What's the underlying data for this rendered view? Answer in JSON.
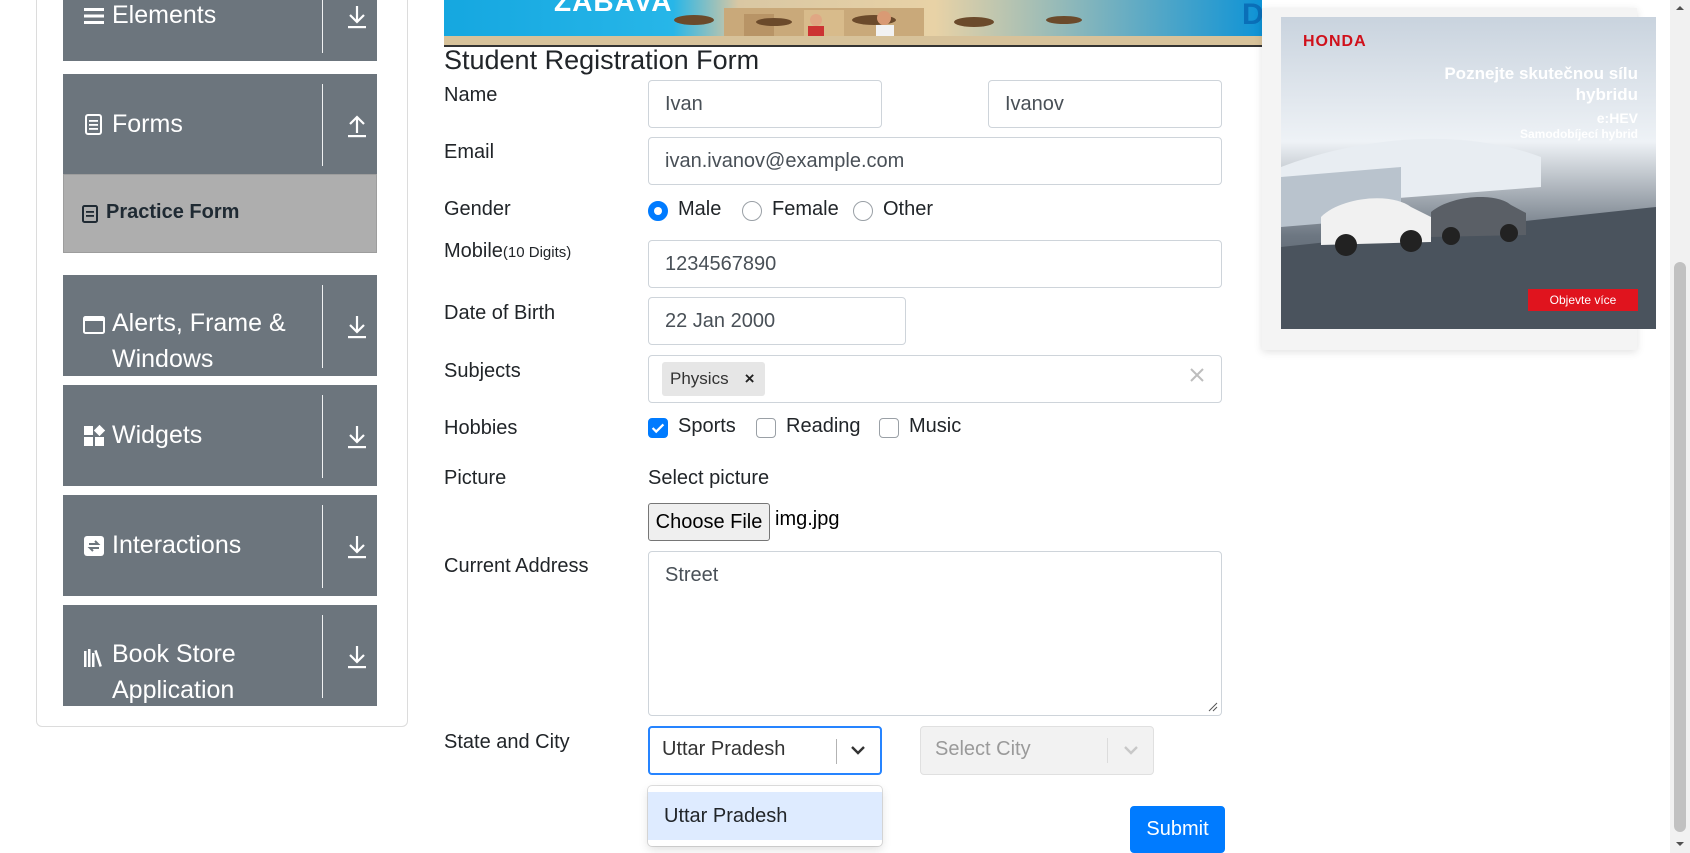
{
  "sidebar": {
    "groups": [
      {
        "label": "Elements",
        "icon": "hamburger-icon",
        "toggle": "expand-icon"
      },
      {
        "label": "Forms",
        "icon": "document-icon",
        "toggle": "collapse-icon"
      },
      {
        "label": "Alerts, Frame & Windows",
        "icon": "window-icon",
        "toggle": "expand-icon"
      },
      {
        "label": "Widgets",
        "icon": "widgets-icon",
        "toggle": "expand-icon"
      },
      {
        "label": "Interactions",
        "icon": "interactions-icon",
        "toggle": "expand-icon"
      },
      {
        "label": "Book Store Application",
        "icon": "books-icon",
        "toggle": "expand-icon"
      }
    ],
    "active_item": "Practice Form"
  },
  "banner": {
    "text": "ZABAVA",
    "letter": "D"
  },
  "form": {
    "title": "Student Registration Form",
    "name_label": "Name",
    "first_name": "Ivan",
    "last_name": "Ivanov",
    "email_label": "Email",
    "email": "ivan.ivanov@example.com",
    "gender_label": "Gender",
    "gender_options": [
      "Male",
      "Female",
      "Other"
    ],
    "gender_selected": "Male",
    "mobile_label": "Mobile",
    "mobile_hint": "(10 Digits)",
    "mobile": "1234567890",
    "dob_label": "Date of Birth",
    "dob": "22 Jan 2000",
    "subjects_label": "Subjects",
    "subjects": [
      "Physics"
    ],
    "hobbies_label": "Hobbies",
    "hobbies": [
      "Sports",
      "Reading",
      "Music"
    ],
    "hobbies_checked": [
      "Sports"
    ],
    "picture_label": "Picture",
    "picture_hint": "Select picture",
    "choose_file_label": "Choose File",
    "file_name": "img.jpg",
    "address_label": "Current Address",
    "address": "Street",
    "state_city_label": "State and City",
    "state_value": "Uttar Pradesh",
    "city_placeholder": "Select City",
    "state_menu_options": [
      "Uttar Pradesh"
    ],
    "submit_label": "Submit"
  },
  "ad": {
    "brand": "HONDA",
    "headline": "Poznejte skutečnou sílu hybridu",
    "badge": "e:HEV",
    "subline": "Samodobíjecí hybrid",
    "cta": "Objevte více"
  },
  "colors": {
    "primary": "#007bff",
    "sidebar_group": "#6c757d",
    "active_item_bg": "#aeaeae",
    "menu_option_bg": "#deebff",
    "focus_border": "#2684ff"
  }
}
